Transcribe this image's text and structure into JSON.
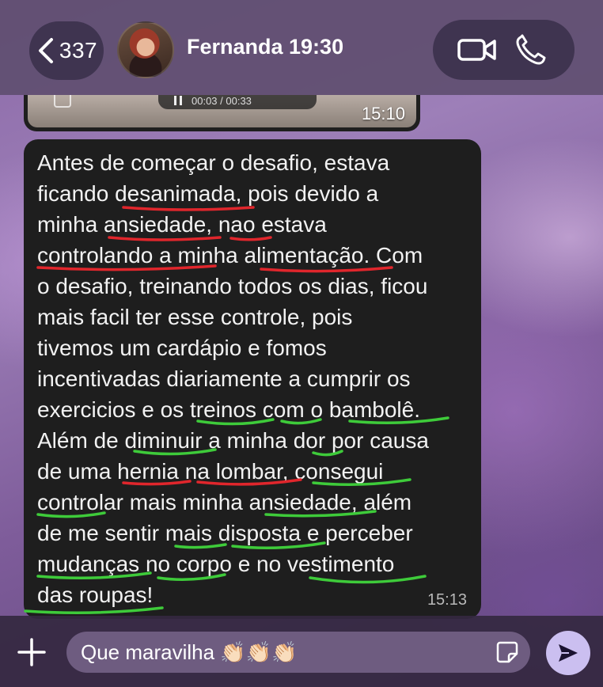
{
  "header": {
    "back_count": "337",
    "contact_name": "Fernanda 19:30"
  },
  "media_message": {
    "player_time": "00:03 / 00:33",
    "time": "15:10"
  },
  "message": {
    "text": "Antes de começar o desafio, estava\nficando desanimada, pois devido a\nminha ansiedade, nao estava\ncontrolando a minha alimentação. Com\no desafio, treinando todos os dias, ficou\nmais facil ter esse controle, pois\ntivemos um cardápio e fomos\nincentivadas diariamente a cumprir os\nexercicios e os treinos com o bambolê.\nAlém de diminuir a minha dor por causa\nde uma hernia na lombar, consegui\ncontrolar mais minha ansiedade, além\nde me sentir mais disposta e perceber\nmudanças no corpo e no vestimento\ndas roupas!",
    "time": "15:13"
  },
  "composer": {
    "input_value": "Que maravilha 👏🏻👏🏻👏🏻"
  },
  "colors": {
    "header_bg": "#5f4e70",
    "bubble_bg": "#1e1e1e",
    "send_button": "#cbbff0",
    "underline_red": "#e0262c",
    "underline_green": "#3ecb3a"
  },
  "icons": [
    "chevron-left-icon",
    "video-call-icon",
    "phone-icon",
    "plus-icon",
    "sticker-icon",
    "send-icon",
    "pause-icon"
  ]
}
